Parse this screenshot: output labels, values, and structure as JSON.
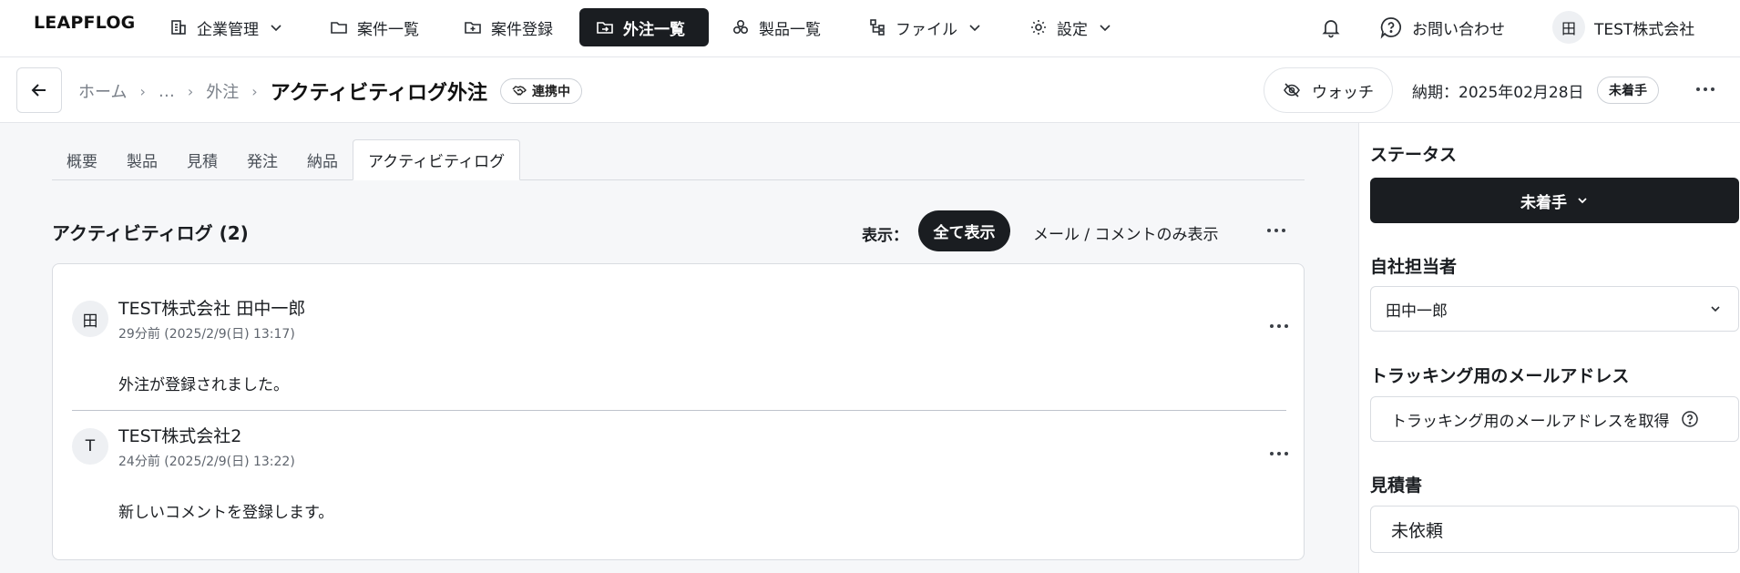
{
  "app": {
    "logo": "LEAPFLOG"
  },
  "nav": {
    "items": [
      {
        "label": "企業管理",
        "icon": "building-icon",
        "has_dropdown": true
      },
      {
        "label": "案件一覧",
        "icon": "folder-icon",
        "has_dropdown": false
      },
      {
        "label": "案件登録",
        "icon": "folder-plus-icon",
        "has_dropdown": false
      },
      {
        "label": "外注一覧",
        "icon": "folder-export-icon",
        "has_dropdown": false,
        "active": true
      },
      {
        "label": "製品一覧",
        "icon": "cubes-icon",
        "has_dropdown": false
      },
      {
        "label": "ファイル",
        "icon": "file-tree-icon",
        "has_dropdown": true
      },
      {
        "label": "設定",
        "icon": "gear-icon",
        "has_dropdown": true
      }
    ],
    "contact_label": "お問い合わせ",
    "company_avatar": "田",
    "company_name": "TEST株式会社"
  },
  "subheader": {
    "breadcrumbs": [
      "ホーム",
      "…",
      "外注"
    ],
    "title": "アクティビティログ外注",
    "linked_badge": "連携中",
    "watch_label": "ウォッチ",
    "due": "納期：2025年02月28日",
    "status": "未着手"
  },
  "tabs": [
    "概要",
    "製品",
    "見積",
    "発注",
    "納品",
    "アクティビティログ"
  ],
  "activity": {
    "title": "アクティビティログ (2)",
    "filter_label": "表示：",
    "filter_all": "全て表示",
    "filter_mail": "メール / コメントのみ表示",
    "entries": [
      {
        "avatar": "田",
        "name": "TEST株式会社 田中一郎",
        "time": "29分前 (2025/2/9(日) 13:17)",
        "body": "外注が登録されました。"
      },
      {
        "avatar": "T",
        "name": "TEST株式会社2",
        "time": "24分前 (2025/2/9(日) 13:22)",
        "body": "新しいコメントを登録します。"
      }
    ]
  },
  "panel": {
    "status_label": "ステータス",
    "status_value": "未着手",
    "owner_label": "自社担当者",
    "owner_value": "田中一郎",
    "tracking_label": "トラッキング用のメールアドレス",
    "tracking_button": "トラッキング用のメールアドレスを取得",
    "quote_label": "見積書",
    "quote_value": "未依頼"
  },
  "colors": {
    "primary_dark": "#1a1d21",
    "border": "#d9dce1",
    "background": "#f6f7f9"
  }
}
